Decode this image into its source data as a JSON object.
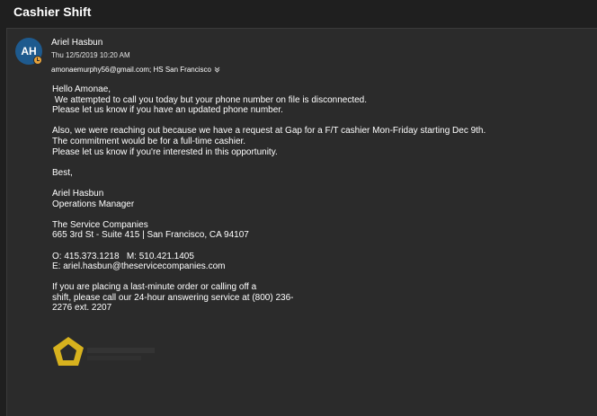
{
  "subject": "Cashier Shift",
  "sender": {
    "initials": "AH",
    "name": "Ariel Hasbun",
    "datetime": "Thu 12/5/2019 10:20 AM",
    "recipients": "amonaemurphy56@gmail.com; HS San Francisco"
  },
  "body": {
    "greeting": "Hello Amonae,",
    "p1_line1": " We attempted to call you today but your phone number on file is disconnected.",
    "p1_line2": "Please let us know if you have an updated phone number.",
    "p2_line1": "Also, we were reaching out because we have a request at Gap for a F/T cashier Mon-Friday starting Dec 9th.",
    "p2_line2": "The commitment would be for a full-time cashier.",
    "p2_line3": "Please let us know if you're interested in this opportunity.",
    "closing": "Best,",
    "sig_name": "Ariel Hasbun",
    "sig_title": "Operations Manager",
    "company": "The Service Companies",
    "address": "665 3rd St - Suite 415 | San Francisco, CA 94107",
    "phones": "O: 415.373.1218   M: 510.421.1405",
    "email": "E: ariel.hasbun@theservicecompanies.com",
    "note_line1": "If you are placing a last-minute order or calling off a",
    "note_line2": "shift, please call our 24-hour answering service at (800) 236-",
    "note_line3": "2276 ext. 2207"
  },
  "colors": {
    "background": "#1f1f1f",
    "card": "#2b2b2b",
    "avatar": "#1e5a8e",
    "presence": "#e8a33b",
    "logo": "#d7b21e"
  },
  "icons": [
    "chevron-down-icon",
    "presence-away-icon",
    "company-logo"
  ]
}
